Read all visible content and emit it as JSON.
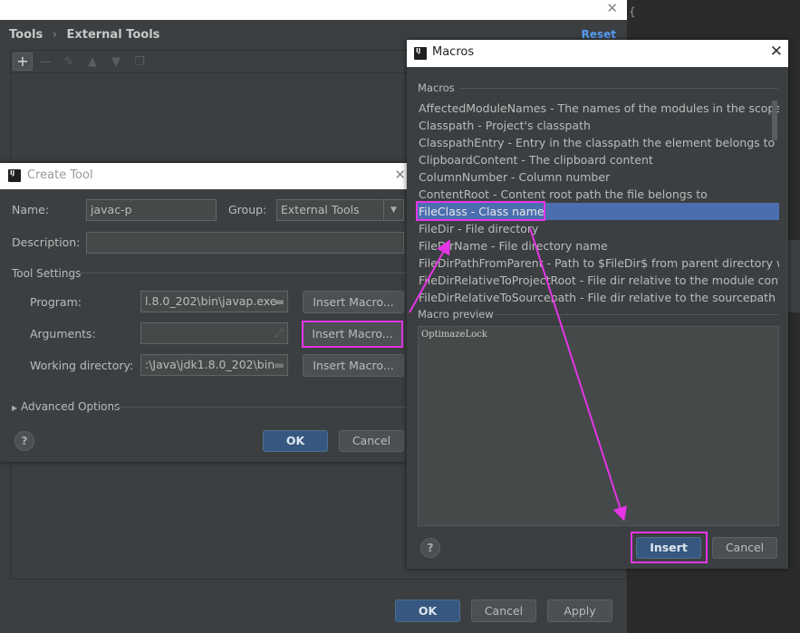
{
  "editor": {
    "brace": "{"
  },
  "settings": {
    "breadcrumb": [
      "Tools",
      "External Tools"
    ],
    "reset_label": "Reset",
    "toolbar_icons": [
      "add-icon",
      "remove-icon",
      "edit-icon",
      "move-up-icon",
      "move-down-icon",
      "copy-icon"
    ],
    "ok_label": "OK",
    "cancel_label": "Cancel",
    "apply_label": "Apply"
  },
  "create_tool": {
    "title": "Create Tool",
    "name_label": "Name:",
    "name_value": "javac-p",
    "group_label": "Group:",
    "group_value": "External Tools",
    "description_label": "Description:",
    "description_value": "",
    "tool_settings_label": "Tool Settings",
    "program_label": "Program:",
    "program_value": "l.8.0_202\\bin\\javap.exe",
    "arguments_label": "Arguments:",
    "arguments_value": "",
    "workdir_label": "Working directory:",
    "workdir_value": ":\\Java\\jdk1.8.0_202\\bin",
    "insert_macro_label": "Insert Macro...",
    "advanced_label": "Advanced Options",
    "ok_label": "OK",
    "cancel_label": "Cancel",
    "help": "?"
  },
  "macros": {
    "title": "Macros",
    "list_label": "Macros",
    "items": [
      "AffectedModuleNames - The names of the modules in the scope, co",
      "Classpath - Project's classpath",
      "ClasspathEntry - Entry in the classpath the element belongs to",
      "ClipboardContent - The clipboard content",
      "ColumnNumber - Column number",
      "ContentRoot - Content root path the file belongs to",
      "FileClass - Class name",
      "FileDir - File directory",
      "FileDirName - File directory name",
      "FileDirPathFromParent - Path to $FileDir$ from parent directory with",
      "FileDirRelativeToProjectRoot - File dir relative to the module content",
      "FileDirRelativeToSourcepath - File dir relative to the sourcepath root"
    ],
    "selected_index": 6,
    "preview_label": "Macro preview",
    "preview_value": "OptimazeLock",
    "insert_label": "Insert",
    "cancel_label": "Cancel",
    "help": "?"
  },
  "colors": {
    "annotation": "#e535e5",
    "selection": "#4b6eaf",
    "accent": "#365880"
  }
}
